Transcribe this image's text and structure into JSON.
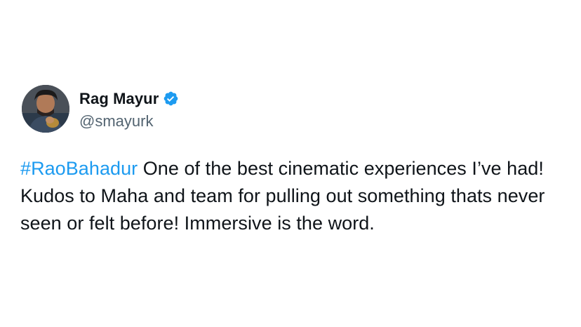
{
  "user": {
    "display_name": "Rag Mayur",
    "handle": "@smayurk",
    "verified_icon": "verified-badge-icon",
    "avatar": "profile-photo"
  },
  "tweet": {
    "hashtag": "#RaoBahadur",
    "body": " One of the best cinematic experiences I’ve had! Kudos to Maha and team for pulling out something thats never seen or felt before! Immersive is the word."
  },
  "colors": {
    "link": "#1d9bf0",
    "text": "#0f1419",
    "secondary_text": "#536471",
    "background": "#ffffff"
  }
}
